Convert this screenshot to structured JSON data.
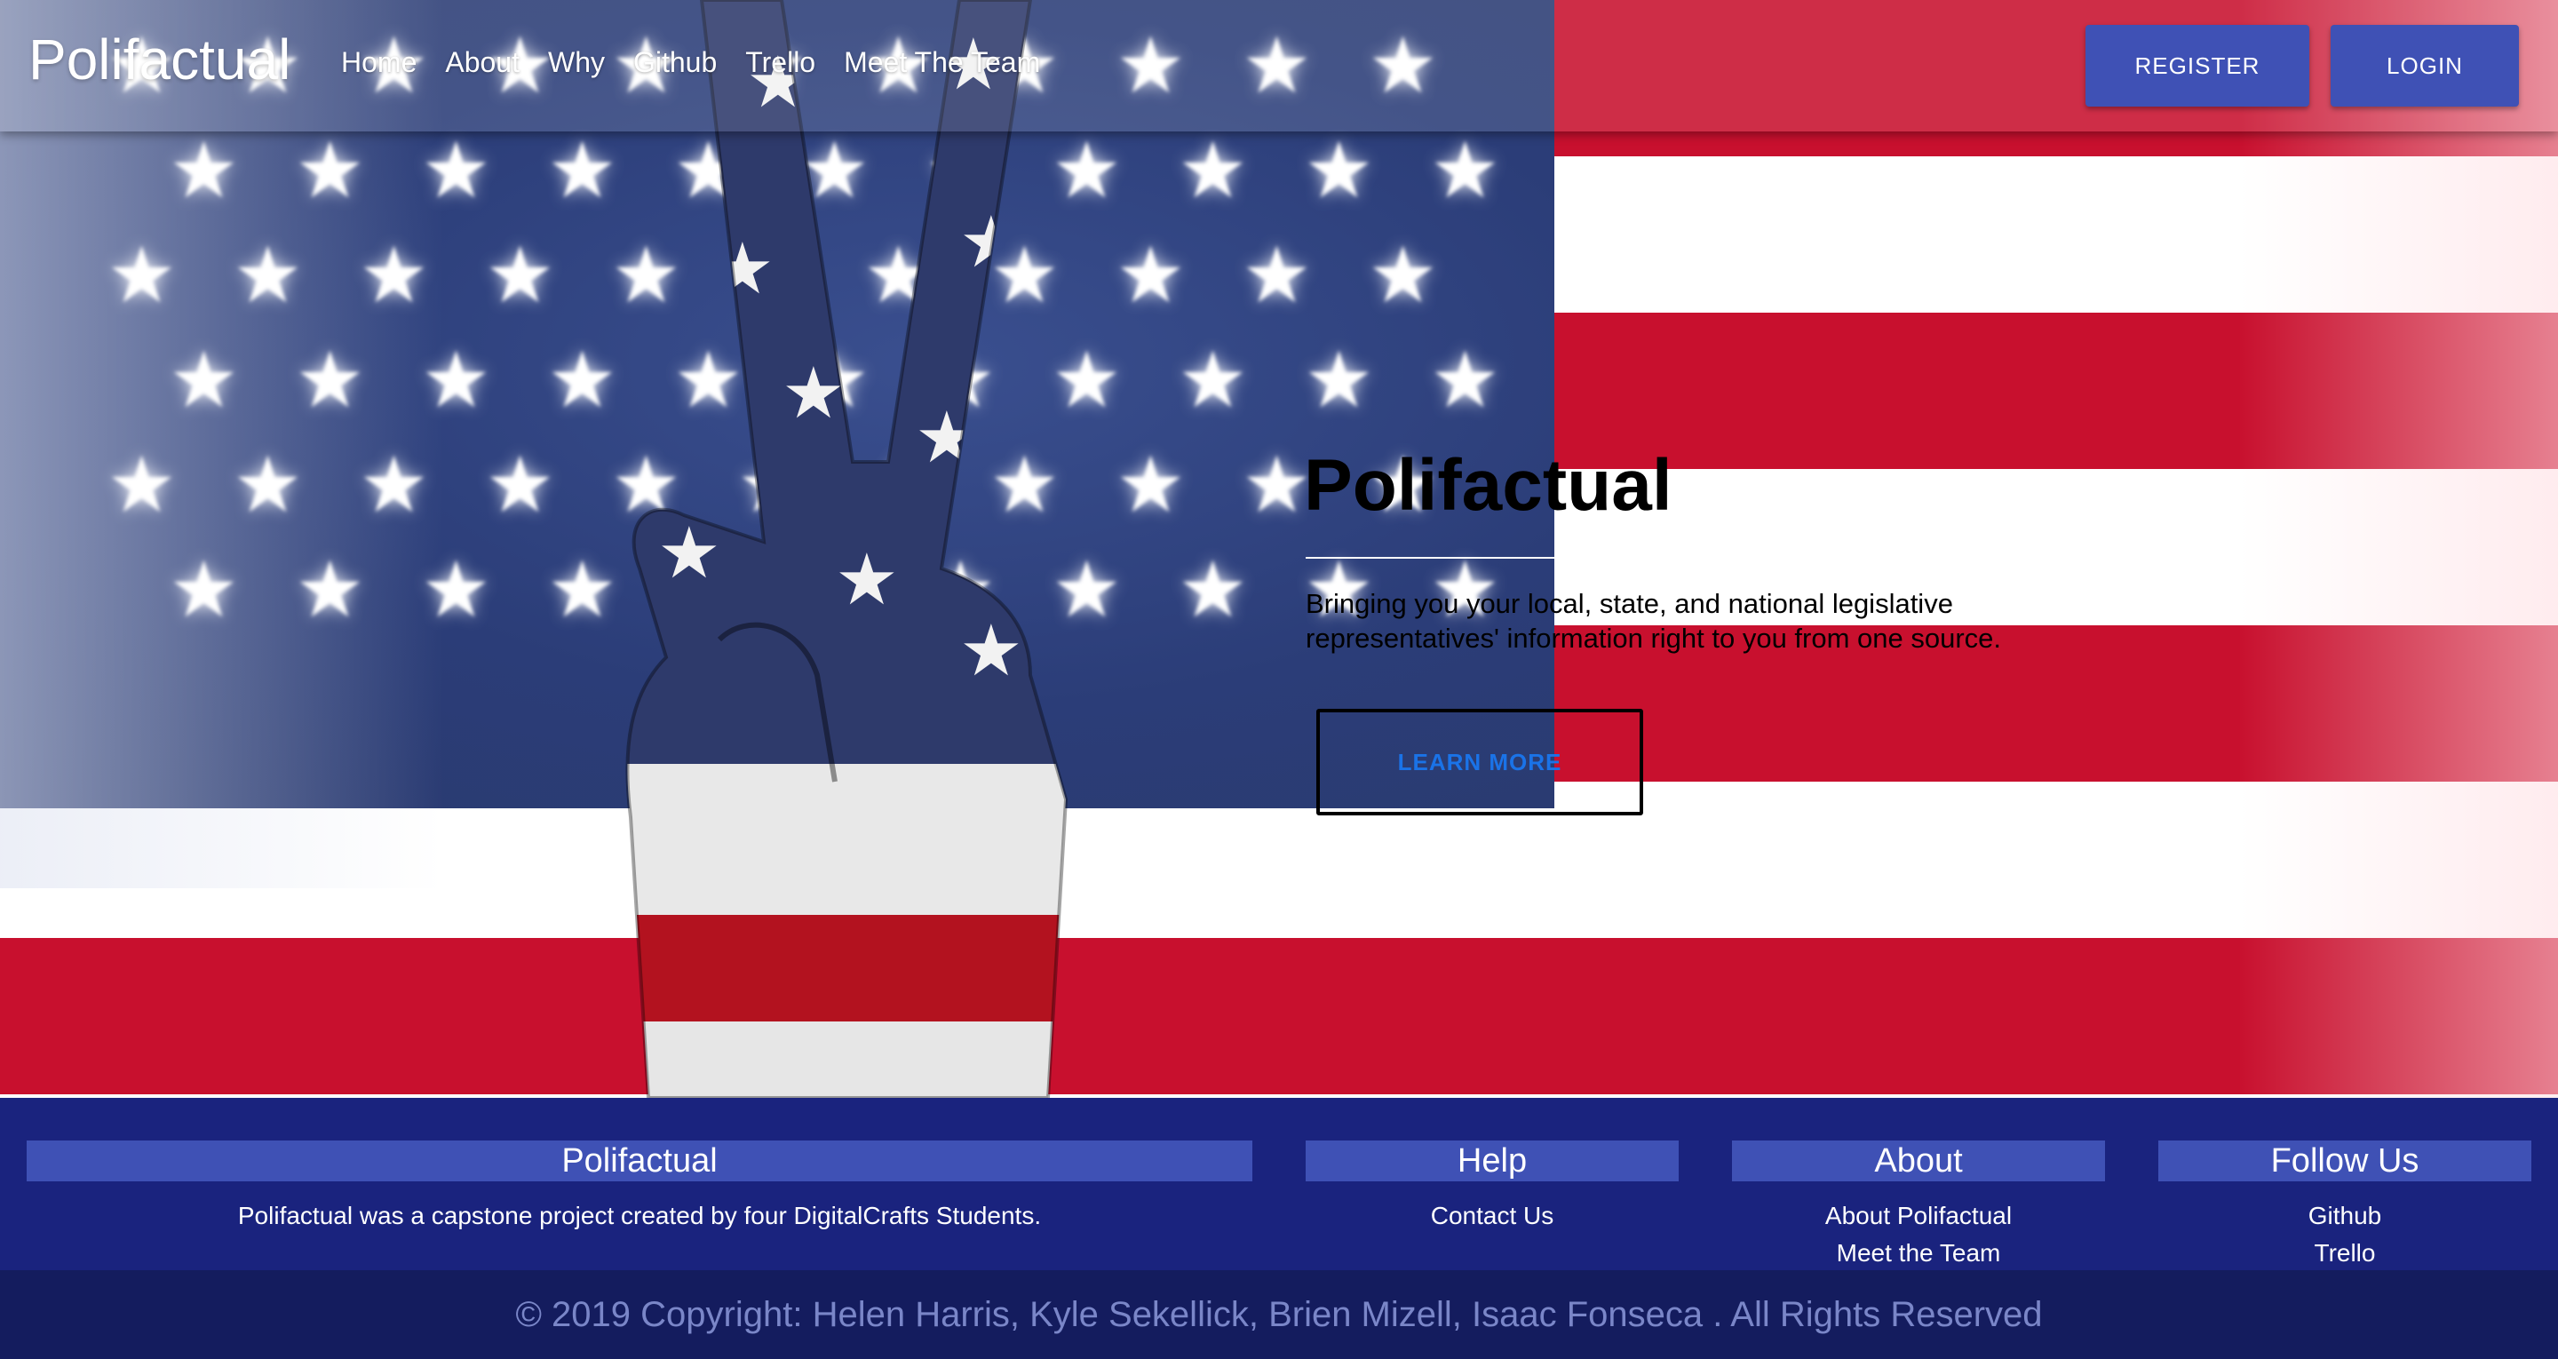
{
  "colors": {
    "primary": "#3f51b5",
    "footer_bg": "#1a237e",
    "copyright_bg": "#141c5e",
    "learn_more_text": "#1a73e8",
    "flag_red": "#c8102e",
    "flag_blue": "#2b3d78"
  },
  "navbar": {
    "brand": "Polifactual",
    "links": [
      "Home",
      "About",
      "Why",
      "Github",
      "Trello",
      "Meet The Team"
    ],
    "register_label": "REGISTER",
    "login_label": "LOGIN"
  },
  "hero": {
    "title": "Polifactual",
    "subtitle": "Bringing you your local, state, and national legislative representatives' information right to you from one source.",
    "cta_label": "LEARN MORE",
    "background_icon": "us-flag-peace-hand"
  },
  "footer": {
    "about_col": {
      "heading": "Polifactual",
      "text": "Polifactual was a capstone project created by four DigitalCrafts Students."
    },
    "help_col": {
      "heading": "Help",
      "links": [
        "Contact Us"
      ]
    },
    "info_col": {
      "heading": "About",
      "links": [
        "About Polifactual",
        "Meet the Team"
      ]
    },
    "follow_col": {
      "heading": "Follow Us",
      "links": [
        "Github",
        "Trello"
      ]
    },
    "copyright": "© 2019 Copyright: Helen Harris, Kyle Sekellick, Brien Mizell, Isaac Fonseca . All Rights Reserved"
  }
}
